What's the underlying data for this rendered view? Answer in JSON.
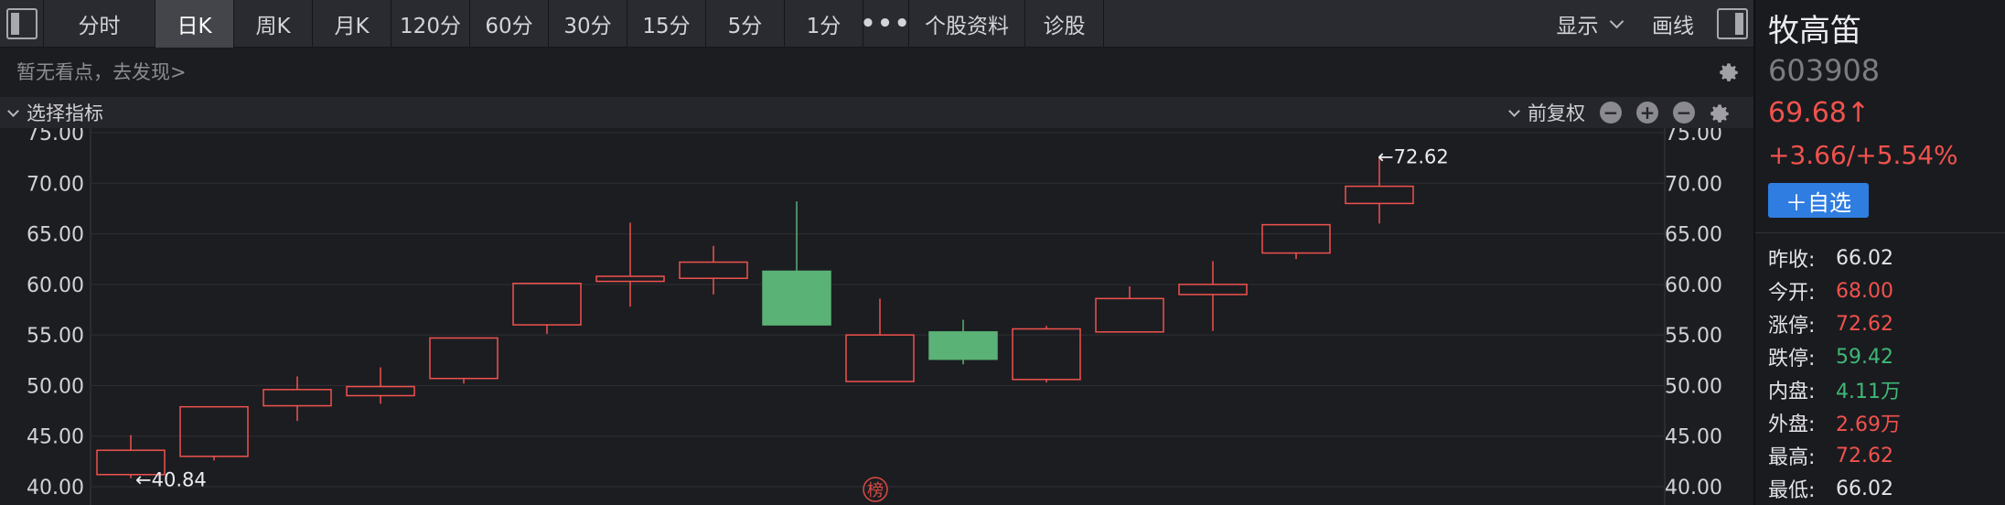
{
  "toolbar": {
    "tabs": [
      {
        "label": "分时",
        "width": 122,
        "active": false
      },
      {
        "label": "日K",
        "width": 86,
        "active": true
      },
      {
        "label": "周K",
        "width": 86,
        "active": false
      },
      {
        "label": "月K",
        "width": 86,
        "active": false
      },
      {
        "label": "120分",
        "width": 86,
        "active": false
      },
      {
        "label": "60分",
        "width": 86,
        "active": false
      },
      {
        "label": "30分",
        "width": 86,
        "active": false
      },
      {
        "label": "15分",
        "width": 86,
        "active": false
      },
      {
        "label": "5分",
        "width": 86,
        "active": false
      },
      {
        "label": "1分",
        "width": 86,
        "active": false
      }
    ],
    "more": "•••",
    "profile": "个股资料",
    "diagnose": "诊股",
    "display": "显示",
    "draw": "画线"
  },
  "info_line": "暂无看点，去发现>",
  "indicator_bar": {
    "select": "选择指标",
    "adjust": "前复权"
  },
  "chart_data": {
    "type": "candlestick",
    "ylim": [
      40,
      75
    ],
    "yticks": [
      "75.00",
      "70.00",
      "65.00",
      "60.00",
      "55.00",
      "50.00",
      "45.00",
      "40.00"
    ],
    "candles": [
      {
        "open": 41.2,
        "close": 43.6,
        "high": 45.1,
        "low": 40.84,
        "up": true
      },
      {
        "open": 43.0,
        "close": 47.9,
        "high": 47.9,
        "low": 42.6,
        "up": true
      },
      {
        "open": 48.0,
        "close": 49.6,
        "high": 50.9,
        "low": 46.5,
        "up": true
      },
      {
        "open": 49.0,
        "close": 49.9,
        "high": 51.8,
        "low": 48.2,
        "up": true
      },
      {
        "open": 50.7,
        "close": 54.7,
        "high": 54.7,
        "low": 50.2,
        "up": true
      },
      {
        "open": 56.0,
        "close": 60.1,
        "high": 60.1,
        "low": 55.1,
        "up": true
      },
      {
        "open": 60.3,
        "close": 60.8,
        "high": 66.1,
        "low": 57.8,
        "up": true
      },
      {
        "open": 60.6,
        "close": 62.2,
        "high": 63.8,
        "low": 59.0,
        "up": true
      },
      {
        "open": 61.3,
        "close": 56.0,
        "high": 68.2,
        "low": 56.0,
        "up": false
      },
      {
        "open": 50.4,
        "close": 55.0,
        "high": 58.6,
        "low": 50.4,
        "up": true
      },
      {
        "open": 55.3,
        "close": 52.6,
        "high": 56.5,
        "low": 52.1,
        "up": false
      },
      {
        "open": 50.6,
        "close": 55.6,
        "high": 55.9,
        "low": 50.3,
        "up": true
      },
      {
        "open": 55.3,
        "close": 58.6,
        "high": 59.8,
        "low": 55.3,
        "up": true
      },
      {
        "open": 59.0,
        "close": 60.0,
        "high": 62.3,
        "low": 55.4,
        "up": true
      },
      {
        "open": 63.1,
        "close": 65.9,
        "high": 65.9,
        "low": 62.5,
        "up": true
      },
      {
        "open": 68.0,
        "close": 69.7,
        "high": 72.62,
        "low": 66.02,
        "up": true
      }
    ],
    "high_label": "←72.62",
    "low_label": "←40.84",
    "watermark": "榜"
  },
  "stock": {
    "name": "牧高笛",
    "code": "603908",
    "price": "69.68↑",
    "change": "+3.66/+5.54%",
    "add_button": "＋自选",
    "stats": [
      {
        "label": "昨收:",
        "value": "66.02",
        "tone": "neutral"
      },
      {
        "label": "今开:",
        "value": "68.00",
        "tone": "up"
      },
      {
        "label": "涨停:",
        "value": "72.62",
        "tone": "up"
      },
      {
        "label": "跌停:",
        "value": "59.42",
        "tone": "down"
      },
      {
        "label": "内盘:",
        "value": "4.11万",
        "tone": "down"
      },
      {
        "label": "外盘:",
        "value": "2.69万",
        "tone": "up"
      },
      {
        "label": "最高:",
        "value": "72.62",
        "tone": "up"
      },
      {
        "label": "最低:",
        "value": "66.02",
        "tone": "neutral"
      }
    ]
  },
  "colors": {
    "up": "#f0524d",
    "down": "#5bb276",
    "grid": "#2e2f34",
    "axis_text": "#d2d2d6"
  }
}
